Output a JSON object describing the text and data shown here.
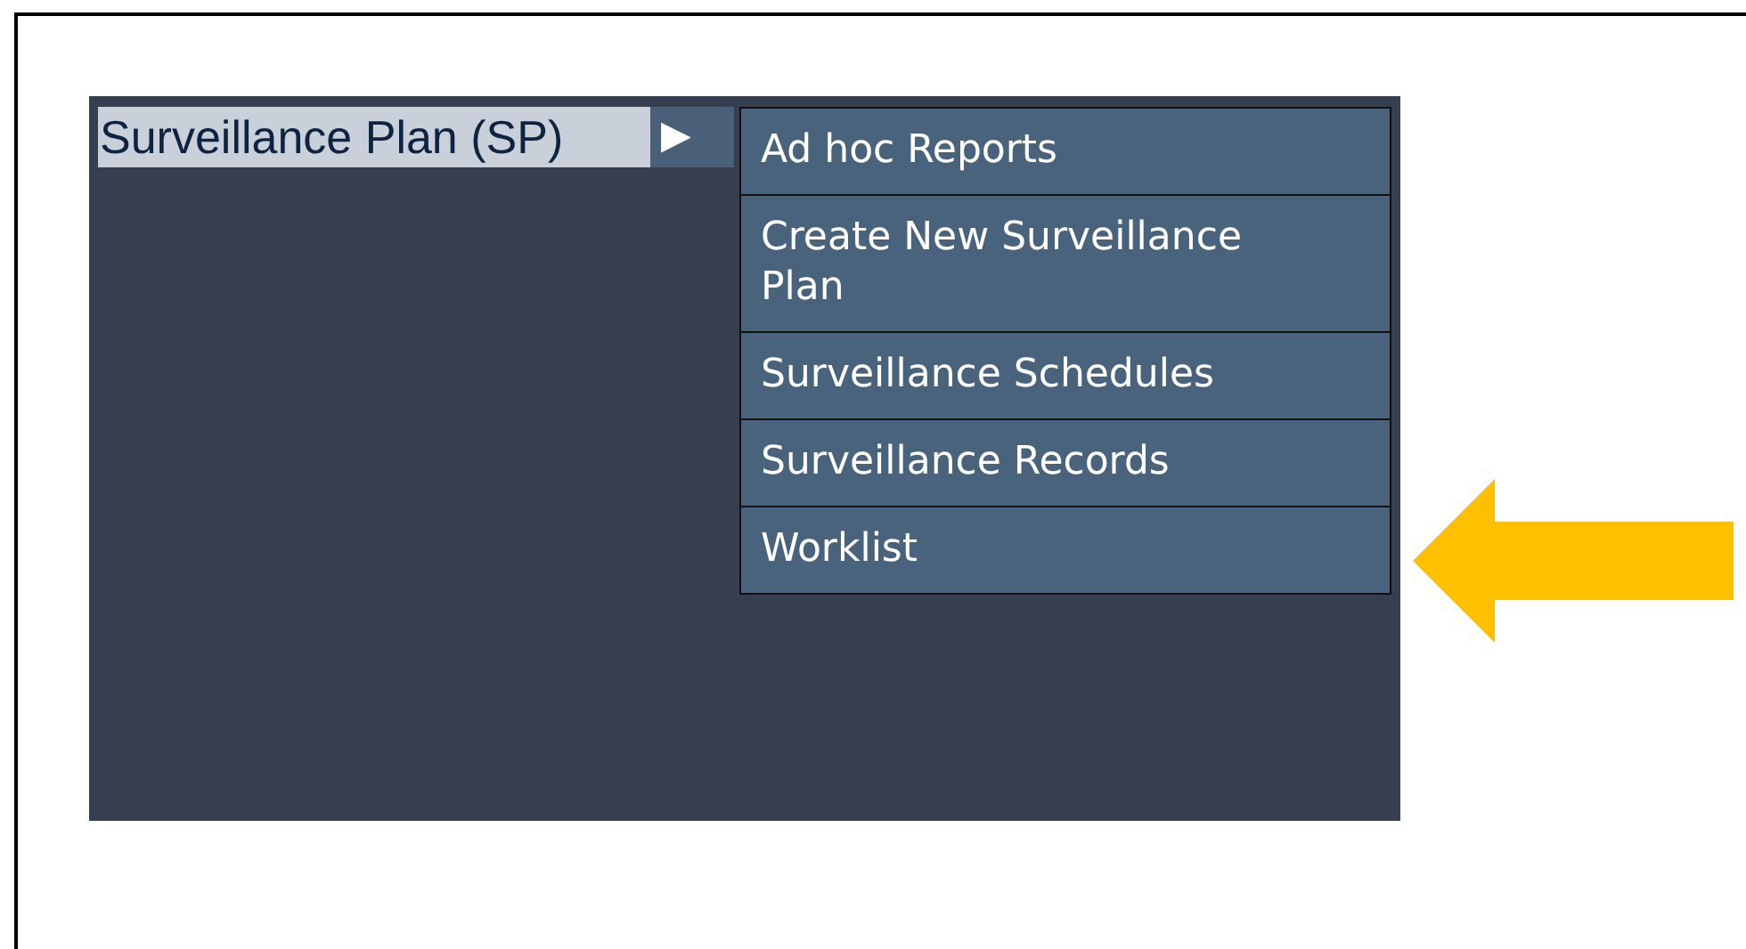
{
  "menu": {
    "label": "Surveillance Plan (SP)",
    "arrow": "▶",
    "highlighted": true
  },
  "submenu": [
    {
      "label": "Ad hoc Reports"
    },
    {
      "label": "Create New Surveillance Plan"
    },
    {
      "label": "Surveillance Schedules"
    },
    {
      "label": "Surveillance Records"
    },
    {
      "label": "Worklist"
    }
  ]
}
